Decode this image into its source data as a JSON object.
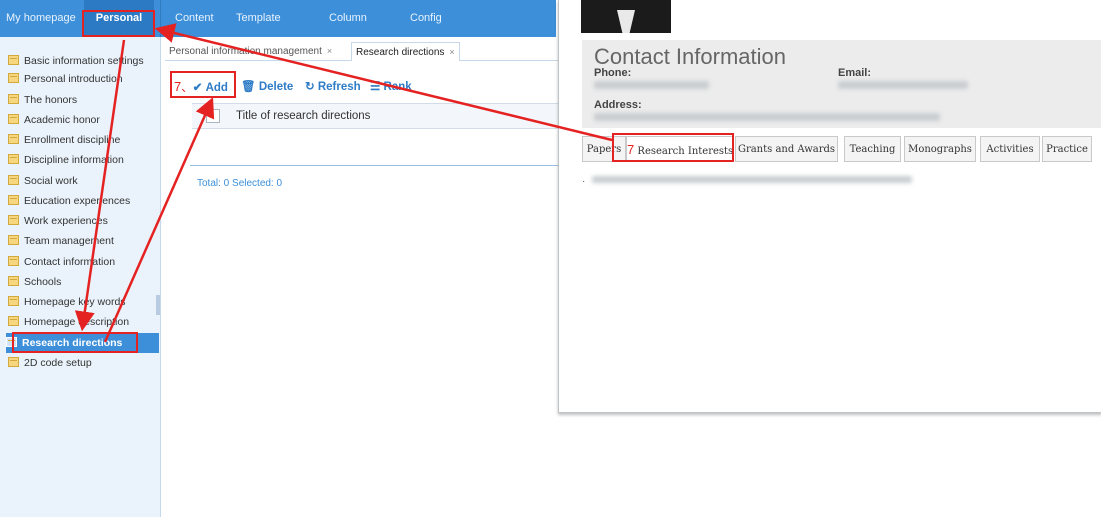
{
  "topnav": {
    "items": [
      "My homepage",
      "Personal",
      "Content",
      "Template",
      "Column",
      "Config"
    ]
  },
  "sidebar": {
    "items": [
      "Basic information settings",
      "Personal introduction",
      "The honors",
      "Academic honor",
      "Enrollment discipline",
      "Discipline information",
      "Social work",
      "Education experiences",
      "Work experiences",
      "Team management",
      "Contact information",
      "Schools",
      "Homepage key words",
      "Homepage description",
      "Research directions",
      "2D code setup"
    ],
    "selected": "Research directions"
  },
  "tabs": [
    {
      "label": "Personal information management",
      "close": "×"
    },
    {
      "label": "Research directions",
      "close": "×"
    }
  ],
  "toolbar": {
    "step_number": "7",
    "add": "Add",
    "delete": "Delete",
    "refresh": "Refresh",
    "rank": "Rank"
  },
  "grid": {
    "header": "Title of research directions",
    "footer": "Total: 0 Selected: 0"
  },
  "profile": {
    "contact_title": "Contact Information",
    "phone_label": "Phone:",
    "email_label": "Email:",
    "address_label": "Address:",
    "step_number": "7",
    "tabs": [
      "Papers",
      "Research Interests",
      "Grants and Awards",
      "Teaching",
      "Monographs",
      "Activities",
      "Practice"
    ],
    "bullet": "·"
  },
  "colors": {
    "nav_blue": "#3c8fd8",
    "selected_blue": "#3c8fd8",
    "annotation_red": "#e52222",
    "toolbar_blue": "#2e7cc7"
  }
}
